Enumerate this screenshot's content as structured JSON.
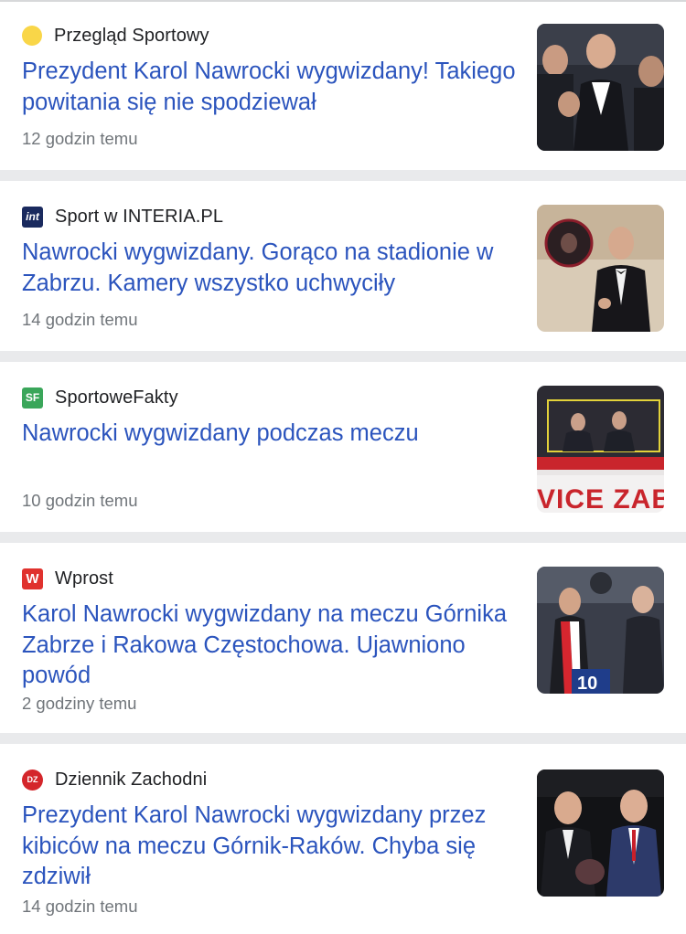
{
  "articles": [
    {
      "source": "Przegląd Sportowy",
      "favicon_icon": "yellow-dot-icon",
      "favicon_color": "#f9d648",
      "favicon_text": "",
      "title": "Prezydent Karol Nawrocki wygwizdany! Takiego powitania się nie spodziewał",
      "time": "12 godzin temu"
    },
    {
      "source": "Sport w INTERIA.PL",
      "favicon_icon": "interia-logo-icon",
      "favicon_color": "#1a2a5e",
      "favicon_text": "int",
      "title": "Nawrocki wygwizdany. Gorąco na stadionie w Zabrzu. Kamery wszystko uchwyciły",
      "time": "14 godzin temu"
    },
    {
      "source": "SportoweFakty",
      "favicon_icon": "sportowefakty-logo-icon",
      "favicon_color": "#3aa65a",
      "favicon_text": "SF",
      "title": "Nawrocki wygwizdany podczas meczu",
      "time": "10 godzin temu",
      "thumb_caption": "VICE ZAB"
    },
    {
      "source": "Wprost",
      "favicon_icon": "wprost-logo-icon",
      "favicon_color": "#e0322e",
      "favicon_text": "W",
      "title": "Karol Nawrocki wygwizdany na meczu Górnika Zabrze i Rakowa Częstochowa. Ujawniono powód",
      "time": "2 godziny temu",
      "thumb_caption": "10"
    },
    {
      "source": "Dziennik Zachodni",
      "favicon_icon": "dziennik-zachodni-logo-icon",
      "favicon_color": "#d4262b",
      "favicon_text": "DZ",
      "title": "Prezydent Karol Nawrocki wygwizdany przez kibiców na meczu Górnik-Raków. Chyba się zdziwił",
      "time": "14 godzin temu"
    }
  ]
}
